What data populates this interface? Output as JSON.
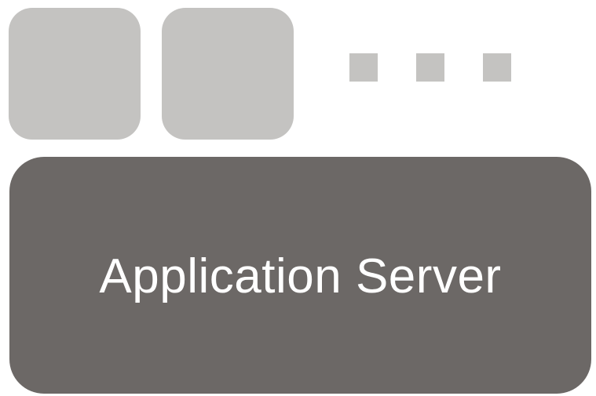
{
  "diagram": {
    "tiles": [
      {
        "color": "#c4c3c1"
      },
      {
        "color": "#c4c3c1"
      }
    ],
    "ellipsis_dots": [
      {
        "color": "#c4c3c1"
      },
      {
        "color": "#c4c3c1"
      },
      {
        "color": "#c4c3c1"
      }
    ],
    "server": {
      "label": "Application Server",
      "color": "#6c6866",
      "text_color": "#ffffff"
    }
  }
}
